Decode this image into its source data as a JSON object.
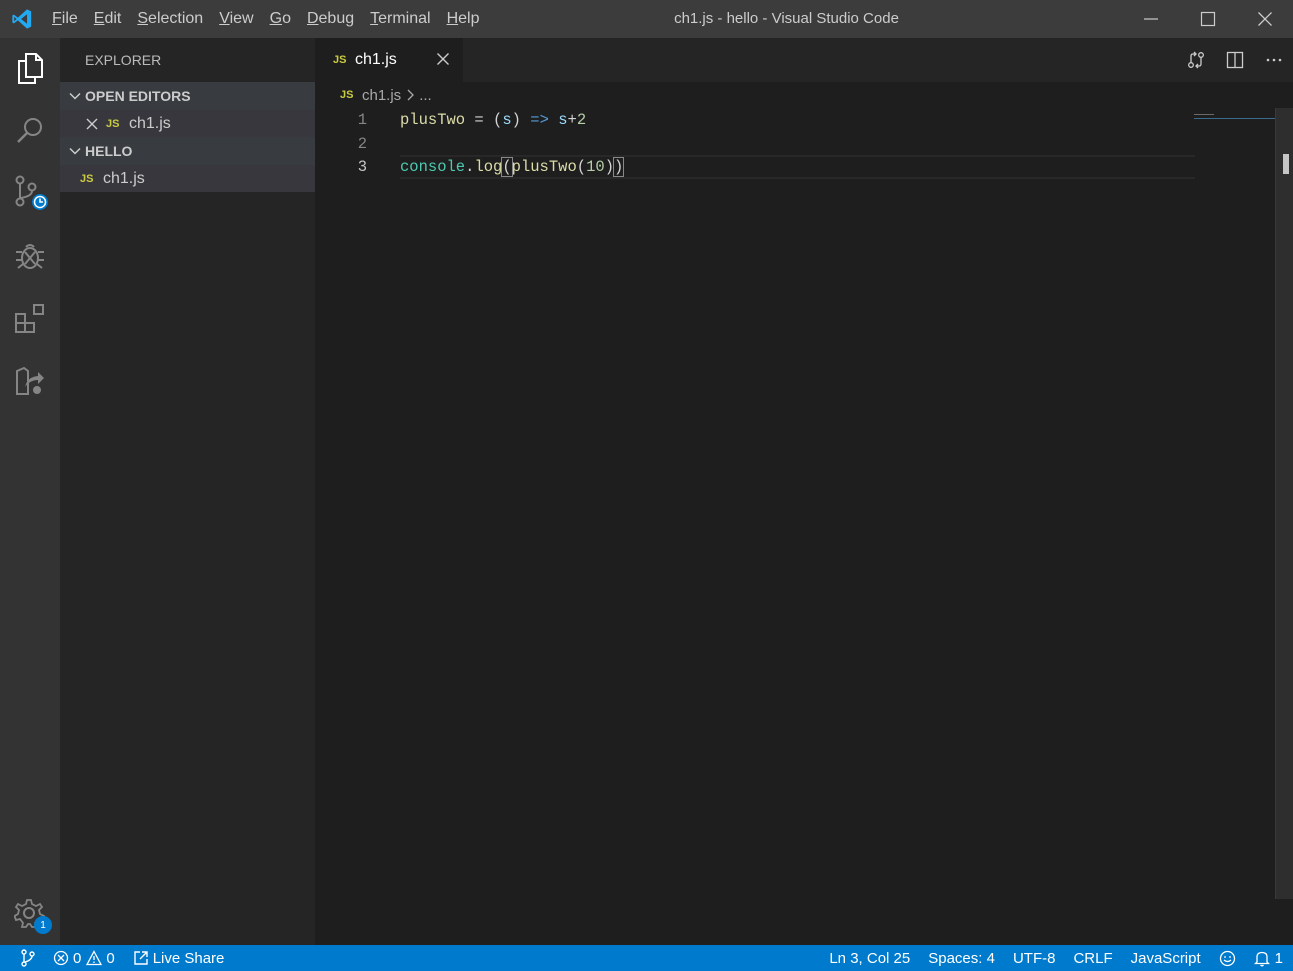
{
  "window": {
    "title": "ch1.js - hello - Visual Studio Code"
  },
  "menu": {
    "items": [
      {
        "accel": "F",
        "rest": "ile"
      },
      {
        "accel": "E",
        "rest": "dit"
      },
      {
        "accel": "S",
        "rest": "election"
      },
      {
        "accel": "V",
        "rest": "iew"
      },
      {
        "accel": "G",
        "rest": "o"
      },
      {
        "accel": "D",
        "rest": "ebug"
      },
      {
        "accel": "T",
        "rest": "erminal"
      },
      {
        "accel": "H",
        "rest": "elp"
      }
    ]
  },
  "activity": {
    "icons": [
      "explorer-icon",
      "search-icon",
      "source-control-icon",
      "debug-icon",
      "extensions-icon",
      "live-share-icon",
      "manage-gear-icon"
    ],
    "manage_badge": "1"
  },
  "sidebar": {
    "title": "EXPLORER",
    "open_editors": {
      "label": "OPEN EDITORS",
      "files": [
        {
          "icon": "JS",
          "name": "ch1.js"
        }
      ]
    },
    "folder": {
      "label": "HELLO",
      "files": [
        {
          "icon": "JS",
          "name": "ch1.js"
        }
      ]
    }
  },
  "tabs": [
    {
      "icon": "JS",
      "label": "ch1.js"
    }
  ],
  "breadcrumb": {
    "icon": "JS",
    "file": "ch1.js",
    "rest": "..."
  },
  "editor": {
    "lines": [
      {
        "num": "1",
        "text": "plusTwo = (s) => s+2"
      },
      {
        "num": "2",
        "text": ""
      },
      {
        "num": "3",
        "text": "console.log(plusTwo(10))"
      }
    ],
    "tokens": {
      "l1": [
        "plusTwo",
        " = ",
        "(",
        "s",
        ")",
        " ",
        "=>",
        " ",
        "s",
        "+",
        "2"
      ],
      "l3": [
        "console",
        ".",
        "log",
        "(",
        "plusTwo",
        "(",
        "10",
        ")",
        ")"
      ]
    }
  },
  "status": {
    "errors": "0",
    "warnings": "0",
    "live_share": "Live Share",
    "position": "Ln 3, Col 25",
    "spaces": "Spaces: 4",
    "encoding": "UTF-8",
    "eol": "CRLF",
    "language": "JavaScript",
    "notifications": "1"
  },
  "colors": {
    "accent": "#007acc",
    "titlebar": "#3c3c3c",
    "activitybar": "#333333",
    "sidebar": "#252526",
    "editor": "#1e1e1e",
    "js_icon": "#cbcb41"
  }
}
